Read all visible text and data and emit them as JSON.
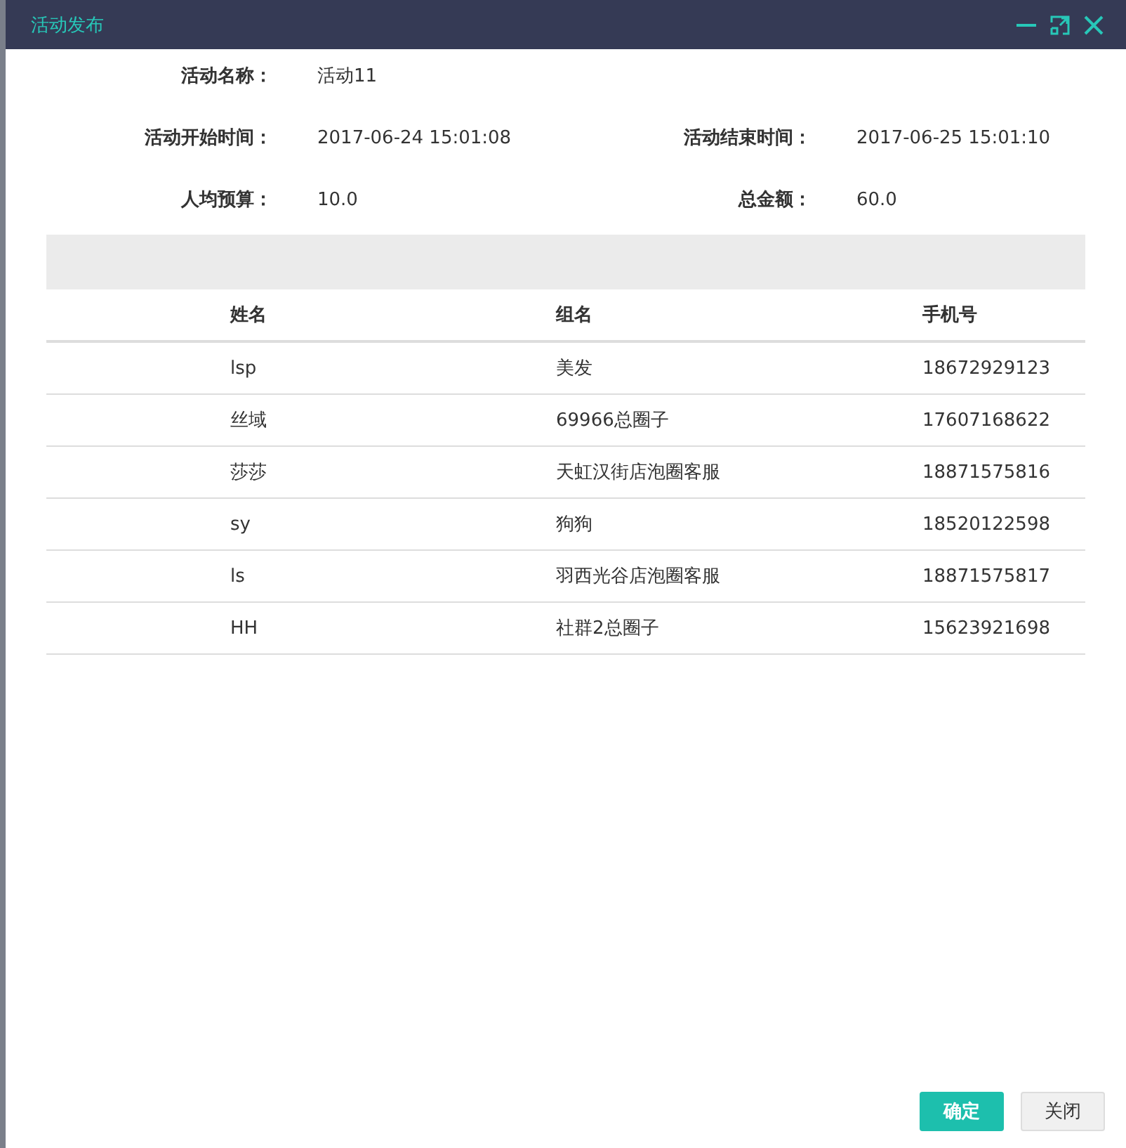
{
  "window": {
    "title": "活动发布"
  },
  "fields": [
    {
      "label": "活动名称：",
      "value": "活动11"
    },
    {
      "label": "活动开始时间：",
      "value": "2017-06-24 15:01:08"
    },
    {
      "label": "活动结束时间：",
      "value": "2017-06-25 15:01:10"
    },
    {
      "label": "人均预算：",
      "value": "10.0"
    },
    {
      "label": "总金额：",
      "value": "60.0"
    }
  ],
  "table": {
    "columns": [
      "姓名",
      "组名",
      "手机号"
    ],
    "rows": [
      [
        "lsp",
        "美发",
        "18672929123"
      ],
      [
        "丝域",
        "69966总圈子",
        "17607168622"
      ],
      [
        "莎莎",
        "天虹汉街店泡圈客服",
        "18871575816"
      ],
      [
        "sy",
        "狗狗",
        "18520122598"
      ],
      [
        "ls",
        "羽西光谷店泡圈客服",
        "18871575817"
      ],
      [
        "HH",
        "社群2总圈子",
        "15623921698"
      ]
    ]
  },
  "buttons": [
    {
      "label": "确定",
      "kind": "primary"
    },
    {
      "label": "关闭",
      "kind": "default"
    }
  ]
}
